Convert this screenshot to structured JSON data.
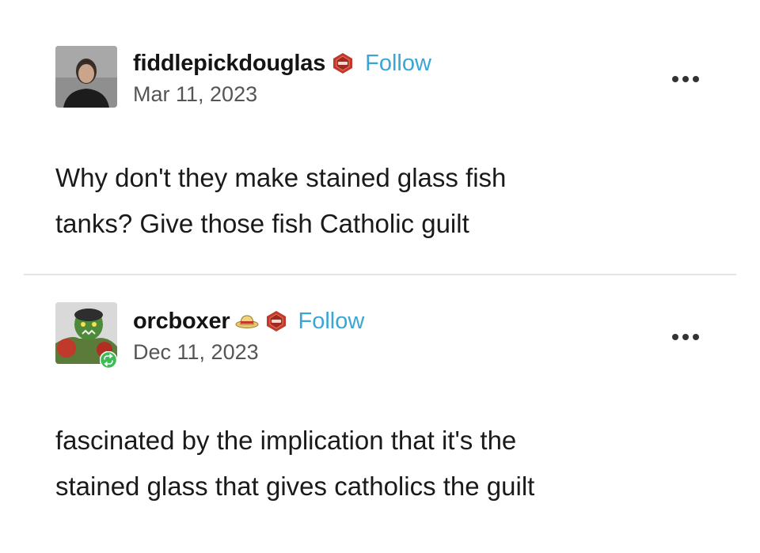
{
  "posts": [
    {
      "username": "fiddlepickdouglas",
      "follow_label": "Follow",
      "date": "Mar 11, 2023",
      "body_lines": [
        "Why don't they make stained glass fish",
        "tanks? Give those fish Catholic guilt"
      ],
      "icons": [
        "avatar-photo",
        "crest-badge-icon",
        "more-options-icon"
      ]
    },
    {
      "username": "orcboxer",
      "follow_label": "Follow",
      "date": "Dec 11, 2023",
      "body_lines": [
        "fascinated by the implication that it's the",
        "stained glass that gives catholics the guilt"
      ],
      "icons": [
        "avatar-orc",
        "reblog-icon",
        "straw-hat-icon",
        "crest-badge-icon",
        "more-options-icon"
      ]
    }
  ],
  "colors": {
    "follow": "#3aa6d6",
    "crest": "#c0392b",
    "reblog_badge": "#3dbb54",
    "divider": "#e4e4e4"
  }
}
